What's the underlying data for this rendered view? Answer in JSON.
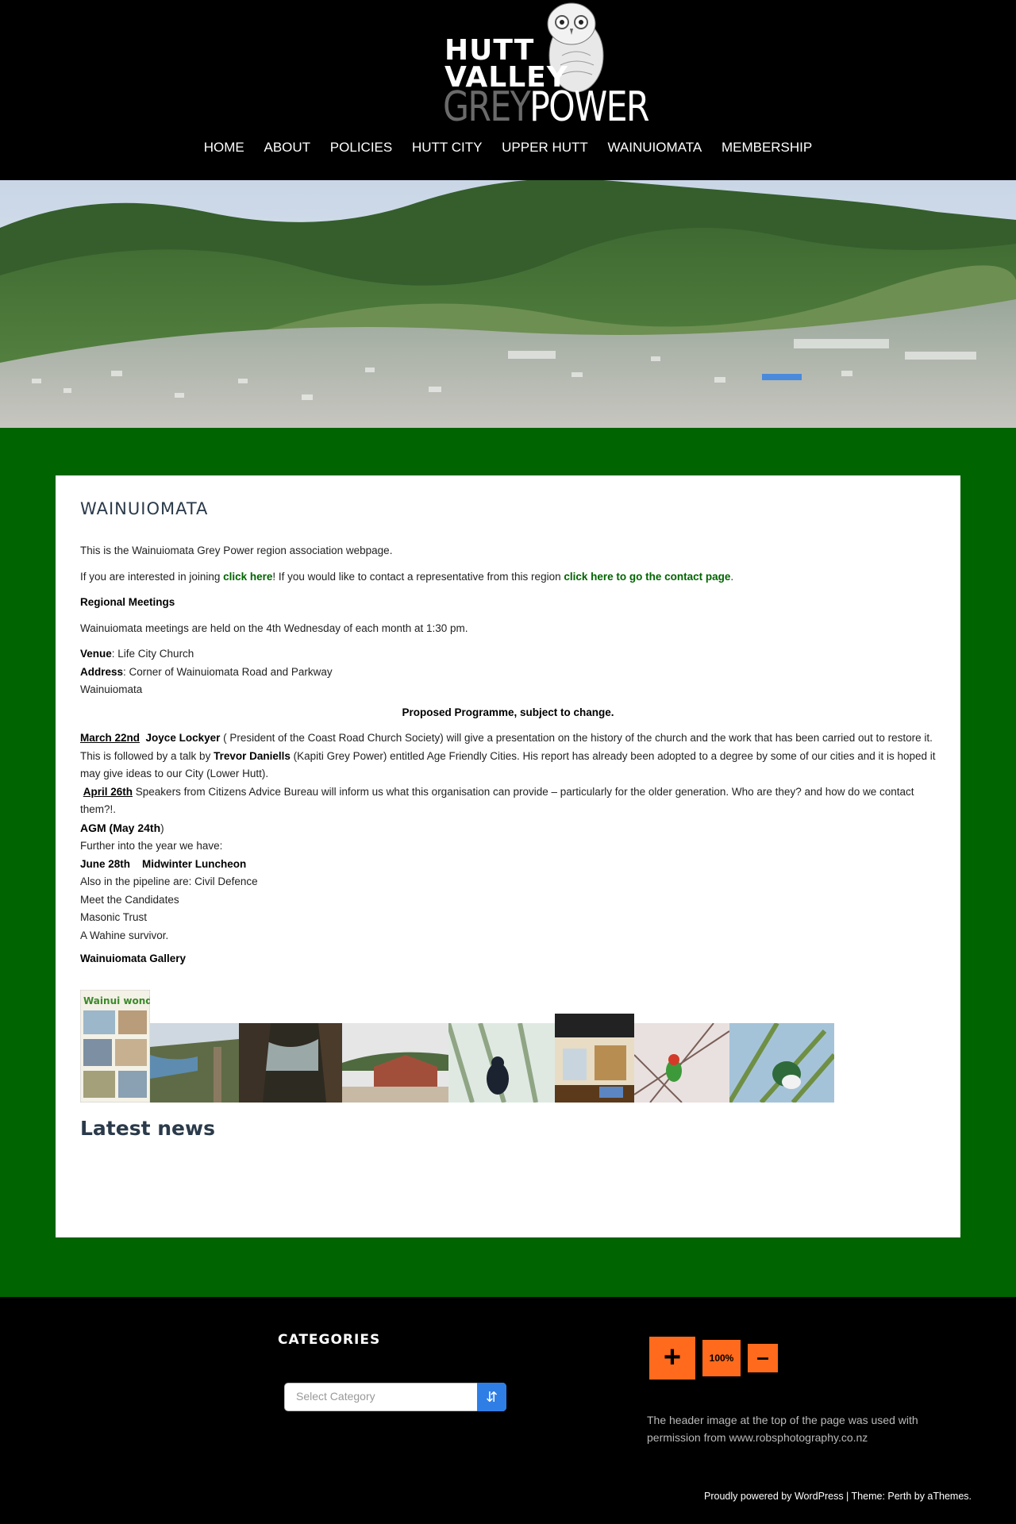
{
  "header": {
    "logo": {
      "line1": "HUTT",
      "line2": "VALLEY",
      "grey": "GREY",
      "power": "POWER",
      "icon": "owl-icon"
    },
    "nav": [
      "HOME",
      "ABOUT",
      "POLICIES",
      "HUTT CITY",
      "UPPER HUTT",
      "WAINUIOMATA",
      "MEMBERSHIP"
    ]
  },
  "page": {
    "title": "WAINUIOMATA",
    "intro": "This is the Wainuiomata Grey Power region association webpage.",
    "join_pre": "If you are interested in joining ",
    "join_link": "click here",
    "join_mid": "! If you would like to contact a representative from this region ",
    "contact_link": "click here to go the contact page",
    "join_post": ".",
    "meetings_heading": "Regional Meetings",
    "meetings_text": "Wainuiomata meetings are held on the 4th Wednesday of each month at 1:30 pm.",
    "venue_label": "Venue",
    "venue_value": ": Life City Church",
    "address_label": "Address",
    "address_value": ": Corner of Wainuiomata Road and Parkway",
    "address_line2": "Wainuiomata",
    "programme_heading": "Proposed Programme, subject to change.",
    "march_date": "March 22nd",
    "march_speaker": "Joyce Lockyer",
    "march_text1": " ( President of the Coast Road Church Society) will give a presentation on the history of the church and the work that has been carried out to restore it.   This is followed by a talk by ",
    "march_speaker2": "Trevor Daniells",
    "march_text2": " (Kapiti Grey Power) entitled Age Friendly Cities. His report has already been adopted to a degree by some of our cities and it is hoped it may give ideas to our City (Lower Hutt).",
    "april_date": "April 26th",
    "april_text": "  Speakers from Citizens Advice Bureau will inform us what this organisation can provide – particularly for the older generation. Who are they? and how do we contact them?!.",
    "agm_bold": "AGM (May 24th",
    "agm_close": ")",
    "further": "Further into the year we have:",
    "june_date": "June 28th",
    "june_event": "Midwinter Luncheon",
    "pipeline": "Also in the pipeline are: Civil Defence",
    "candidates": "Meet the Candidates",
    "masonic": "Masonic Trust",
    "wahine": "A Wahine survivor.",
    "gallery_heading": "Wainuiomata Gallery",
    "gallery_thumb1_caption": "Wainui wonders",
    "latest_news": "Latest news"
  },
  "footer": {
    "categories_title": "CATEGORIES",
    "select_placeholder": "Select Category",
    "zoom_in": "+",
    "zoom_level": "100%",
    "zoom_out": "–",
    "credit_text": "The header image at the top of the page was used with permission from www.robsphotography.co.nz",
    "powered_text": "Proudly powered by WordPress | Theme: Perth by aThemes."
  },
  "colors": {
    "green": "#006400",
    "orange": "#ff6a1c",
    "title": "#2b3a4a",
    "select_arrow": "#2f7ee6"
  }
}
